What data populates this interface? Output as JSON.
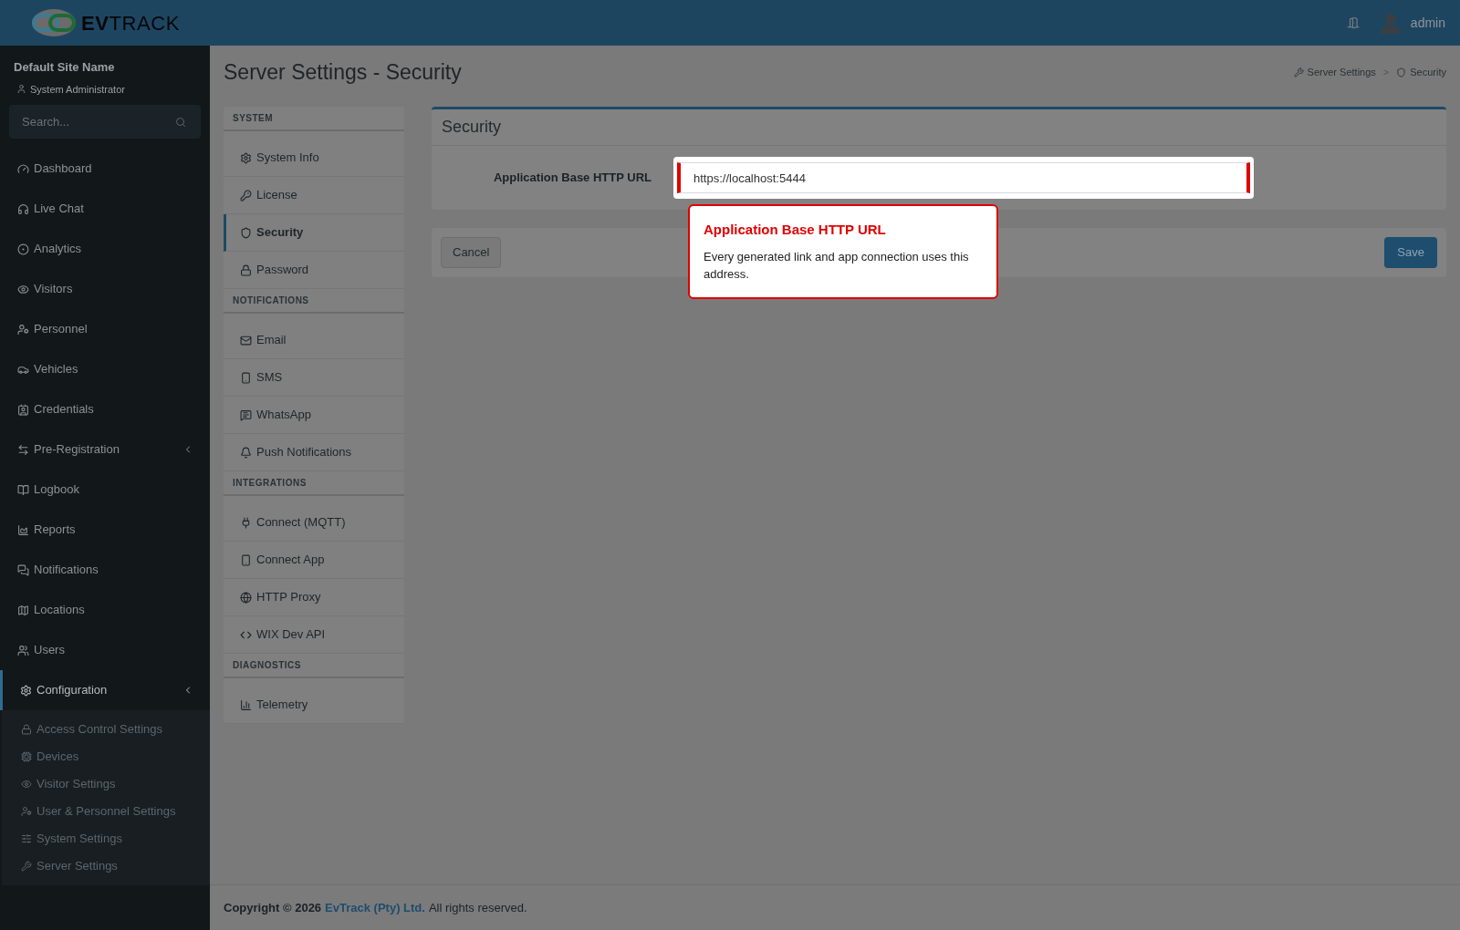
{
  "header": {
    "logo": {
      "bold": "EV",
      "light": "TRACK"
    },
    "user": "admin"
  },
  "sidebar": {
    "site_name": "Default Site Name",
    "role": "System Administrator",
    "search": {
      "placeholder": "Search..."
    },
    "items": [
      {
        "label": "Dashboard",
        "selected": false
      },
      {
        "label": "Live Chat",
        "selected": false
      },
      {
        "label": "Analytics",
        "selected": false
      },
      {
        "label": "Visitors",
        "selected": false
      },
      {
        "label": "Personnel",
        "selected": false
      },
      {
        "label": "Vehicles",
        "selected": false
      },
      {
        "label": "Credentials",
        "selected": false
      },
      {
        "label": "Pre-Registration",
        "selected": false,
        "has_children": true
      },
      {
        "label": "Logbook",
        "selected": false
      },
      {
        "label": "Reports",
        "selected": false
      },
      {
        "label": "Notifications",
        "selected": false
      },
      {
        "label": "Locations",
        "selected": false
      },
      {
        "label": "Users",
        "selected": false
      },
      {
        "label": "Configuration",
        "selected": true,
        "expanded": true,
        "has_children": true,
        "children": [
          {
            "label": "Access Control Settings"
          },
          {
            "label": "Devices"
          },
          {
            "label": "Visitor Settings"
          },
          {
            "label": "User & Personnel Settings"
          },
          {
            "label": "System Settings"
          },
          {
            "label": "Server Settings"
          }
        ]
      }
    ]
  },
  "page": {
    "title": "Server Settings - Security",
    "breadcrumbs": [
      "Server Settings",
      "Security"
    ],
    "breadcrumb_separator": ">"
  },
  "settings_nav": [
    {
      "section": "SYSTEM",
      "items": [
        {
          "label": "System Info",
          "selected": false
        },
        {
          "label": "License",
          "selected": false
        },
        {
          "label": "Security",
          "selected": true
        },
        {
          "label": "Password",
          "selected": false
        }
      ]
    },
    {
      "section": "NOTIFICATIONS",
      "items": [
        {
          "label": "Email",
          "selected": false
        },
        {
          "label": "SMS",
          "selected": false
        },
        {
          "label": "WhatsApp",
          "selected": false
        },
        {
          "label": "Push Notifications",
          "selected": false
        }
      ]
    },
    {
      "section": "INTEGRATIONS",
      "items": [
        {
          "label": "Connect (MQTT)",
          "selected": false
        },
        {
          "label": "Connect App",
          "selected": false
        },
        {
          "label": "HTTP Proxy",
          "selected": false
        },
        {
          "label": "WIX Dev API",
          "selected": false
        }
      ]
    },
    {
      "section": "DIAGNOSTICS",
      "items": [
        {
          "label": "Telemetry",
          "selected": false
        }
      ]
    }
  ],
  "card": {
    "title": "Security",
    "field": {
      "label": "Application Base HTTP URL",
      "value": "https://localhost:5444"
    }
  },
  "tooltip": {
    "title": "Application Base HTTP URL",
    "text": "Every generated link and app connection uses this address."
  },
  "buttons": {
    "cancel": "Cancel",
    "save": "Save"
  },
  "footer": {
    "prefix": "Copyright © 2026",
    "link": "EvTrack (Pty) Ltd.",
    "suffix": "All rights reserved."
  }
}
